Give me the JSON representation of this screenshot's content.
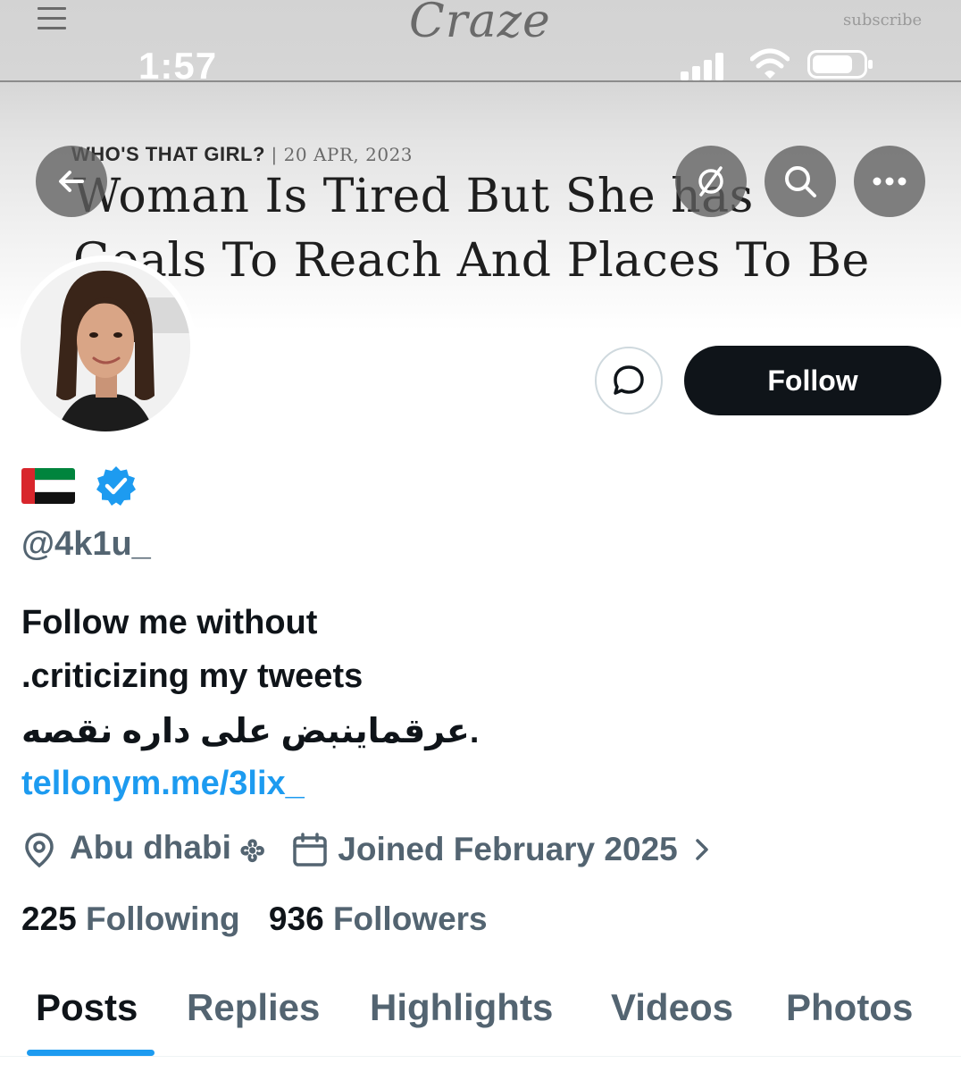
{
  "banner": {
    "logo": "Craze",
    "subscribe": "subscribe",
    "kicker": "WHO'S THAT GIRL?",
    "date": "20 APR, 2023",
    "headline_line1": "Woman Is Tired But She has",
    "headline_line2": "Goals To Reach And Places To Be"
  },
  "status_bar": {
    "time": "1:57"
  },
  "header_icons": [
    "back-arrow-icon",
    "grok-icon",
    "search-icon",
    "more-icon"
  ],
  "profile": {
    "follow_label": "Follow",
    "handle": "@4k1u_",
    "verified": true,
    "bio_line1": "Follow me without",
    "bio_line2": ".criticizing my tweets",
    "bio_line3": "عرقماينبض على داره نقصه.",
    "link": "tellonym.me/3lix_",
    "location": "Abu dhabi 𐫱",
    "joined": "Joined February 2025",
    "following_count": "225",
    "following_label": "Following",
    "followers_count": "936",
    "followers_label": "Followers"
  },
  "tabs": [
    {
      "label": "Posts",
      "active": true
    },
    {
      "label": "Replies",
      "active": false
    },
    {
      "label": "Highlights",
      "active": false
    },
    {
      "label": "Videos",
      "active": false
    },
    {
      "label": "Photos",
      "active": false
    }
  ],
  "colors": {
    "accent": "#1d9bf0",
    "text_primary": "#0f1419",
    "text_secondary": "#536471",
    "follow_bg": "#0f1419"
  }
}
